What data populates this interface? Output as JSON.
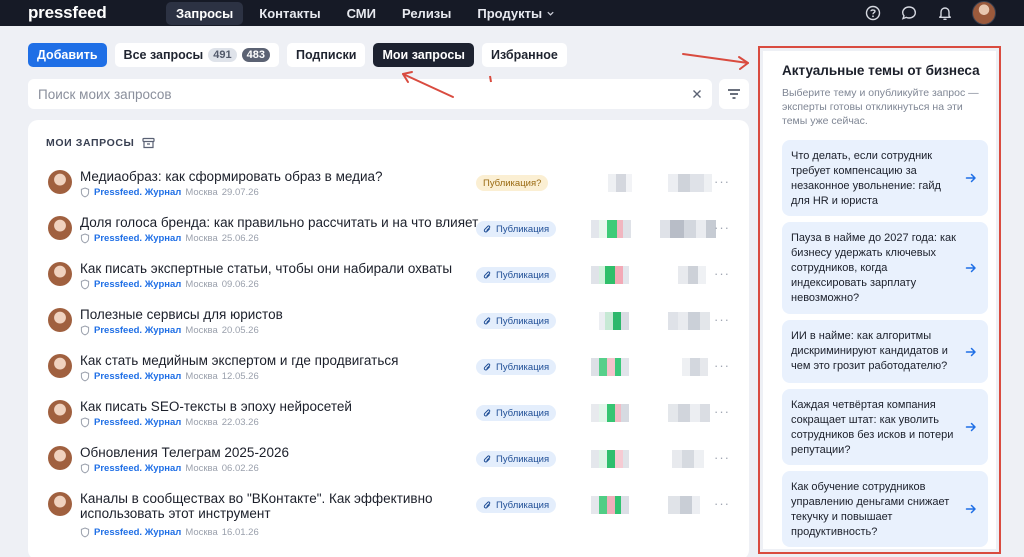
{
  "app": {
    "logo": "pressfeed"
  },
  "nav": {
    "items": [
      {
        "label": "Запросы",
        "active": true
      },
      {
        "label": "Контакты"
      },
      {
        "label": "СМИ"
      },
      {
        "label": "Релизы"
      },
      {
        "label": "Продукты"
      }
    ],
    "icons": [
      "help-icon",
      "chat-icon",
      "bell-icon",
      "avatar"
    ]
  },
  "filters": {
    "add": "Добавить",
    "all": "Все запросы",
    "all_count_a": "491",
    "all_count_b": "483",
    "subscriptions": "Подписки",
    "mine": "Мои запросы",
    "favorites": "Избранное"
  },
  "search": {
    "placeholder": "Поиск моих запросов"
  },
  "list": {
    "header": "МОИ ЗАПРОСЫ",
    "rows": [
      {
        "title": "Медиаобраз: как сформировать образ в медиа?",
        "source": "Pressfeed. Журнал",
        "city": "Москва",
        "date": "29.07.26",
        "status": "Публикация?",
        "status_kind": "pending"
      },
      {
        "title": "Доля голоса бренда: как правильно рассчитать и на что влияет",
        "source": "Pressfeed. Журнал",
        "city": "Москва",
        "date": "25.06.26",
        "status": "Публикация",
        "status_kind": "published"
      },
      {
        "title": "Как писать экспертные статьи, чтобы они набирали охваты",
        "source": "Pressfeed. Журнал",
        "city": "Москва",
        "date": "09.06.26",
        "status": "Публикация",
        "status_kind": "published"
      },
      {
        "title": "Полезные сервисы для юристов",
        "source": "Pressfeed. Журнал",
        "city": "Москва",
        "date": "20.05.26",
        "status": "Публикация",
        "status_kind": "published"
      },
      {
        "title": "Как стать медийным экспертом и где продвигаться",
        "source": "Pressfeed. Журнал",
        "city": "Москва",
        "date": "12.05.26",
        "status": "Публикация",
        "status_kind": "published"
      },
      {
        "title": "Как писать SEO-тексты в эпоху нейросетей",
        "source": "Pressfeed. Журнал",
        "city": "Москва",
        "date": "22.03.26",
        "status": "Публикация",
        "status_kind": "published"
      },
      {
        "title": "Обновления Телеграм 2025-2026",
        "source": "Pressfeed. Журнал",
        "city": "Москва",
        "date": "06.02.26",
        "status": "Публикация",
        "status_kind": "published"
      },
      {
        "title": "Каналы в сообществах во \"ВКонтакте\". Как эффективно использовать этот инструмент",
        "source": "Pressfeed. Журнал",
        "city": "Москва",
        "date": "16.01.26",
        "status": "Публикация",
        "status_kind": "published"
      }
    ]
  },
  "sidebar": {
    "title": "Актуальные темы от бизнеса",
    "description": "Выберите тему и опубликуйте запрос — эксперты готовы откликнуться на эти темы уже сейчас.",
    "topics": [
      {
        "text": "Что делать, если сотрудник требует компенсацию за незаконное увольнение: гайд для HR и юриста"
      },
      {
        "text": "Пауза в найме до 2027 года: как бизнесу удержать ключевых сотрудников, когда индексировать зарплату невозможно?"
      },
      {
        "text": "ИИ в найме: как алгоритмы дискриминируют кандидатов и чем это грозит работодателю?"
      },
      {
        "text": "Каждая четвёртая компания сокращает штат: как уволить сотрудников без исков и потери репутации?"
      },
      {
        "text": "Как обучение сотрудников управлению деньгами снижает текучку и повышает продуктивность?"
      }
    ]
  },
  "colors": {
    "accent": "#1f6fe6",
    "topbar": "#161a26",
    "annotation": "#d94b3f",
    "topic_bg": "#e9f1fd"
  }
}
